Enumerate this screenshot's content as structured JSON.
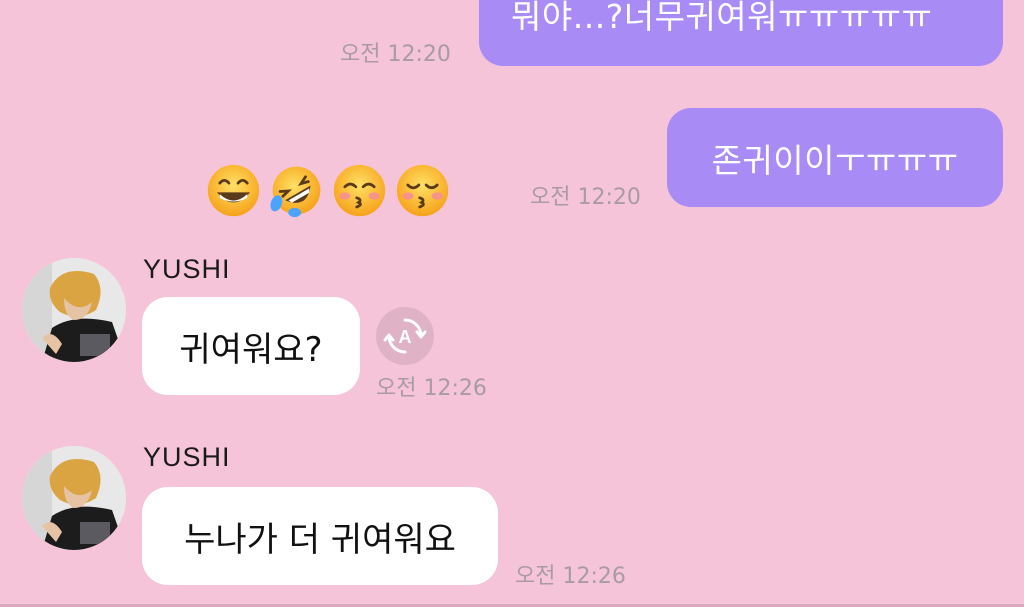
{
  "messages": {
    "outgoing": [
      {
        "text": "뭐야...?너무귀여워ㅠㅠㅠㅠㅠ",
        "time": "오전 12:20"
      },
      {
        "text": "존귀이이ㅜㅠㅠㅠ",
        "time": "오전 12:20"
      }
    ],
    "emojis": [
      {
        "icon": "grinning-face-icon",
        "glyph": "😁"
      },
      {
        "icon": "rolling-on-floor-laughing-icon",
        "glyph": "🤣"
      },
      {
        "icon": "kissing-face-smiling-eyes-icon",
        "glyph": "😚"
      },
      {
        "icon": "kissing-face-closed-eyes-icon",
        "glyph": "😚"
      }
    ],
    "incoming": [
      {
        "sender": "YUSHI",
        "text": "귀여워요?",
        "time": "오전 12:26"
      },
      {
        "sender": "YUSHI",
        "text": "누나가 더 귀여워요",
        "time": "오전 12:26"
      }
    ]
  },
  "translate": {
    "icon": "translate-icon",
    "letter": "A"
  },
  "colors": {
    "background": "#f6c4d8",
    "outgoing_bubble": "#a98bf6",
    "incoming_bubble": "#ffffff",
    "timestamp": "#a89ba4"
  }
}
